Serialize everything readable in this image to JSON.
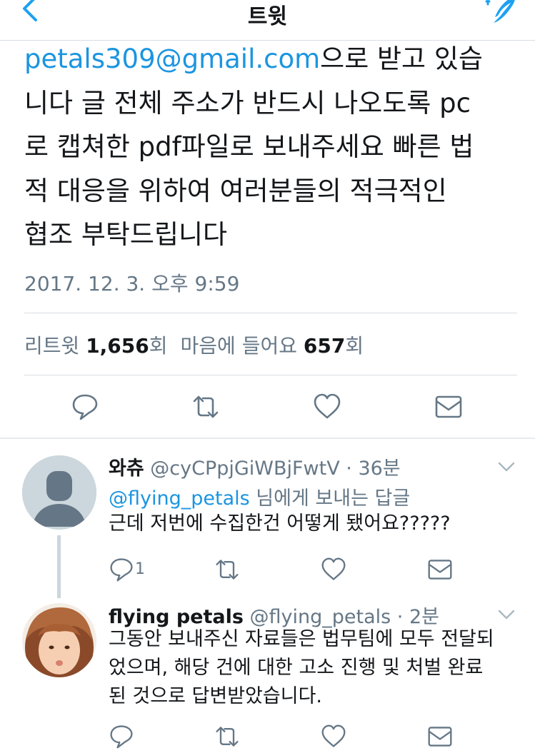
{
  "nav": {
    "title": "트윗",
    "back_icon": "chevron-left-icon",
    "compose_icon": "compose-feather-icon"
  },
  "tweet": {
    "body_link": "petals309@gmail.com",
    "body_rest": "으로 받고 있습\n니다 글 전체 주소가 반드시 나오도록 pc\n로 캡쳐한 pdf파일로 보내주세요 빠른 법\n적 대응을 위하여 여러분들의 적극적인\n협조 부탁드립니다",
    "timestamp": "2017. 12. 3. 오후 9:59",
    "retweet_label": "리트윗",
    "retweet_count": "1,656",
    "retweet_suffix": "회",
    "like_label": "마음에 들어요",
    "like_count": "657",
    "like_suffix": "회"
  },
  "replies": [
    {
      "name": "와츄",
      "handle": "@cyCPpjGiWBjFwtV · 36분",
      "reply_to_link": "@flying_petals",
      "reply_to_suffix": " 님에게 보내는 답글",
      "text": "근데 저번에 수집한건 어떻게 됐어요?????",
      "reply_count": "1"
    },
    {
      "name": "flying petals",
      "handle": "@flying_petals · 2분",
      "text": "그동안 보내주신 자료들은 법무팀에 모두 전달되\n었으며, 해당 건에 대한 고소 진행 및 처벌 완료\n된 것으로 답변받았습니다.",
      "reply_count": ""
    }
  ],
  "colors": {
    "link": "#1b95e0",
    "muted": "#657786",
    "text": "#14171a",
    "divider": "#d8dde2",
    "icon": "#657786",
    "accent": "#1da1f2"
  }
}
